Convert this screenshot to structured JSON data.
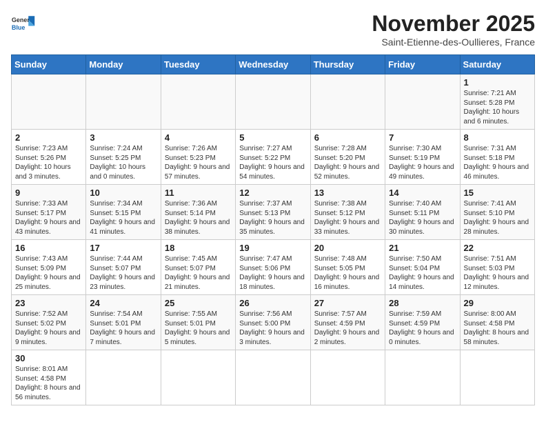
{
  "header": {
    "logo_general": "General",
    "logo_blue": "Blue",
    "month_title": "November 2025",
    "subtitle": "Saint-Etienne-des-Oullieres, France"
  },
  "weekdays": [
    "Sunday",
    "Monday",
    "Tuesday",
    "Wednesday",
    "Thursday",
    "Friday",
    "Saturday"
  ],
  "weeks": [
    [
      {
        "day": "",
        "info": ""
      },
      {
        "day": "",
        "info": ""
      },
      {
        "day": "",
        "info": ""
      },
      {
        "day": "",
        "info": ""
      },
      {
        "day": "",
        "info": ""
      },
      {
        "day": "",
        "info": ""
      },
      {
        "day": "1",
        "info": "Sunrise: 7:21 AM\nSunset: 5:28 PM\nDaylight: 10 hours and 6 minutes."
      }
    ],
    [
      {
        "day": "2",
        "info": "Sunrise: 7:23 AM\nSunset: 5:26 PM\nDaylight: 10 hours and 3 minutes."
      },
      {
        "day": "3",
        "info": "Sunrise: 7:24 AM\nSunset: 5:25 PM\nDaylight: 10 hours and 0 minutes."
      },
      {
        "day": "4",
        "info": "Sunrise: 7:26 AM\nSunset: 5:23 PM\nDaylight: 9 hours and 57 minutes."
      },
      {
        "day": "5",
        "info": "Sunrise: 7:27 AM\nSunset: 5:22 PM\nDaylight: 9 hours and 54 minutes."
      },
      {
        "day": "6",
        "info": "Sunrise: 7:28 AM\nSunset: 5:20 PM\nDaylight: 9 hours and 52 minutes."
      },
      {
        "day": "7",
        "info": "Sunrise: 7:30 AM\nSunset: 5:19 PM\nDaylight: 9 hours and 49 minutes."
      },
      {
        "day": "8",
        "info": "Sunrise: 7:31 AM\nSunset: 5:18 PM\nDaylight: 9 hours and 46 minutes."
      }
    ],
    [
      {
        "day": "9",
        "info": "Sunrise: 7:33 AM\nSunset: 5:17 PM\nDaylight: 9 hours and 43 minutes."
      },
      {
        "day": "10",
        "info": "Sunrise: 7:34 AM\nSunset: 5:15 PM\nDaylight: 9 hours and 41 minutes."
      },
      {
        "day": "11",
        "info": "Sunrise: 7:36 AM\nSunset: 5:14 PM\nDaylight: 9 hours and 38 minutes."
      },
      {
        "day": "12",
        "info": "Sunrise: 7:37 AM\nSunset: 5:13 PM\nDaylight: 9 hours and 35 minutes."
      },
      {
        "day": "13",
        "info": "Sunrise: 7:38 AM\nSunset: 5:12 PM\nDaylight: 9 hours and 33 minutes."
      },
      {
        "day": "14",
        "info": "Sunrise: 7:40 AM\nSunset: 5:11 PM\nDaylight: 9 hours and 30 minutes."
      },
      {
        "day": "15",
        "info": "Sunrise: 7:41 AM\nSunset: 5:10 PM\nDaylight: 9 hours and 28 minutes."
      }
    ],
    [
      {
        "day": "16",
        "info": "Sunrise: 7:43 AM\nSunset: 5:09 PM\nDaylight: 9 hours and 25 minutes."
      },
      {
        "day": "17",
        "info": "Sunrise: 7:44 AM\nSunset: 5:07 PM\nDaylight: 9 hours and 23 minutes."
      },
      {
        "day": "18",
        "info": "Sunrise: 7:45 AM\nSunset: 5:07 PM\nDaylight: 9 hours and 21 minutes."
      },
      {
        "day": "19",
        "info": "Sunrise: 7:47 AM\nSunset: 5:06 PM\nDaylight: 9 hours and 18 minutes."
      },
      {
        "day": "20",
        "info": "Sunrise: 7:48 AM\nSunset: 5:05 PM\nDaylight: 9 hours and 16 minutes."
      },
      {
        "day": "21",
        "info": "Sunrise: 7:50 AM\nSunset: 5:04 PM\nDaylight: 9 hours and 14 minutes."
      },
      {
        "day": "22",
        "info": "Sunrise: 7:51 AM\nSunset: 5:03 PM\nDaylight: 9 hours and 12 minutes."
      }
    ],
    [
      {
        "day": "23",
        "info": "Sunrise: 7:52 AM\nSunset: 5:02 PM\nDaylight: 9 hours and 9 minutes."
      },
      {
        "day": "24",
        "info": "Sunrise: 7:54 AM\nSunset: 5:01 PM\nDaylight: 9 hours and 7 minutes."
      },
      {
        "day": "25",
        "info": "Sunrise: 7:55 AM\nSunset: 5:01 PM\nDaylight: 9 hours and 5 minutes."
      },
      {
        "day": "26",
        "info": "Sunrise: 7:56 AM\nSunset: 5:00 PM\nDaylight: 9 hours and 3 minutes."
      },
      {
        "day": "27",
        "info": "Sunrise: 7:57 AM\nSunset: 4:59 PM\nDaylight: 9 hours and 2 minutes."
      },
      {
        "day": "28",
        "info": "Sunrise: 7:59 AM\nSunset: 4:59 PM\nDaylight: 9 hours and 0 minutes."
      },
      {
        "day": "29",
        "info": "Sunrise: 8:00 AM\nSunset: 4:58 PM\nDaylight: 8 hours and 58 minutes."
      }
    ],
    [
      {
        "day": "30",
        "info": "Sunrise: 8:01 AM\nSunset: 4:58 PM\nDaylight: 8 hours and 56 minutes."
      },
      {
        "day": "",
        "info": ""
      },
      {
        "day": "",
        "info": ""
      },
      {
        "day": "",
        "info": ""
      },
      {
        "day": "",
        "info": ""
      },
      {
        "day": "",
        "info": ""
      },
      {
        "day": "",
        "info": ""
      }
    ]
  ]
}
